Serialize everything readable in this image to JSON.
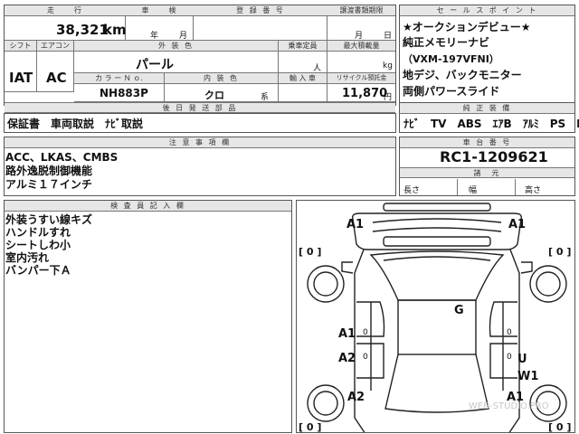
{
  "headers": {
    "mileage": "走　　行",
    "inspection": "車　　検",
    "registration": "登 録 番 号",
    "transfer_deadline": "譲渡書類期限",
    "sales_points": "セ ー ル ス ポ イ ン ト",
    "shift": "シフト",
    "aircon": "エアコン",
    "exterior_color": "外 装 色",
    "capacity": "乗車定員",
    "max_load": "最大積載量",
    "color_no": "カ ラ ー Ｎ ｏ.",
    "interior_color": "内 装 色",
    "import": "輸 入 車",
    "recycle": "リサイクル預託金",
    "equipment": "純 正 装 備",
    "documents": "後 日 発 送 部 品",
    "caution": "注 意 事 項 欄",
    "chassis": "車 台 番 号",
    "dimensions": "諸　元",
    "inspector": "検 査 員 記 入 欄"
  },
  "vehicle": {
    "mileage_value": "38,321",
    "mileage_unit": "km",
    "inspection_year": "年",
    "inspection_month": "月",
    "transfer_month": "月",
    "transfer_day": "日",
    "shift_value": "IAT",
    "aircon_value": "AC",
    "exterior_color_value": "パール",
    "capacity_unit": "人",
    "max_load_unit": "kg",
    "color_no_value": "NH883P",
    "interior_color_value": "クロ",
    "interior_suffix": "系",
    "recycle_value": "11,870",
    "recycle_unit": "円",
    "chassis_value": "RC1-1209621",
    "dim_length": "長さ",
    "dim_width": "幅",
    "dim_height": "高さ"
  },
  "sales_points": [
    "★オークションデビュー★",
    "純正メモリーナビ",
    "（VXM-197VFNI）",
    "地デジ、バックモニター",
    "両側パワースライド"
  ],
  "equipment_value": "ﾅﾋﾞ　TV　ABS　ｴｱB　ｱﾙﾐ　PS　PW",
  "documents_value": "保証書　車両取説　ﾅﾋﾞ取説",
  "caution_lines": [
    "ACC、LKAS、CMBS",
    "路外逸脱制御機能",
    "アルミ１７インチ"
  ],
  "inspector_notes": [
    "外装うすい線キズ",
    "ハンドルすれ",
    "シートしわ小",
    "室内汚れ",
    "バンパー下Ａ"
  ],
  "diagram": {
    "front_left": "A1",
    "front_right": "A1",
    "tire_fl": "[ 0 ]",
    "tire_fr": "[ 0 ]",
    "roof": "G",
    "left_front_door": "A1",
    "left_front_door_val": "0",
    "left_rear_door": "A2",
    "left_rear_door_val": "0",
    "right_front_door": "U",
    "right_front_door_val": "0",
    "right_rear_door": "W1",
    "right_rear_door_val": "0",
    "rear_left": "A2",
    "rear_right": "A1",
    "tire_rl": "[ 0 ]",
    "tire_rr": "[ 0 ]"
  },
  "watermark": "WEB-STUDIO.PRO"
}
